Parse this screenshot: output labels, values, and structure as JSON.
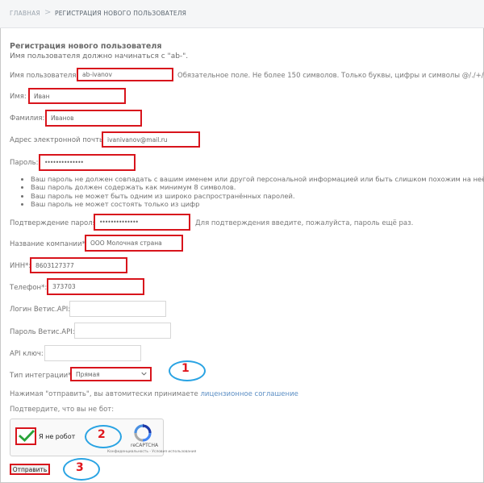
{
  "breadcrumb": {
    "home": "ГЛАВНАЯ",
    "separator": ">",
    "current": "РЕГИСТРАЦИЯ НОВОГО ПОЛЬЗОВАТЕЛЯ"
  },
  "form": {
    "title": "Регистрация нового пользователя",
    "subtitle": "Имя пользователя должно начинаться с \"ab-\".",
    "username": {
      "label": "Имя пользователя:",
      "value": "ab-ivanov",
      "hint": "Обязательное поле. Не более 150 символов. Только буквы, цифры и символы @/./+/-/_."
    },
    "first_name": {
      "label": "Имя:",
      "value": "Иван"
    },
    "last_name": {
      "label": "Фамилия:",
      "value": "Иванов"
    },
    "email": {
      "label": "Адрес электронной почты:",
      "value": "ivanivanov@mail.ru"
    },
    "password": {
      "label": "Пароль:",
      "value": "••••••••••••••",
      "rules": [
        "Ваш пароль не должен совпадать с вашим именем или другой персональной информацией или быть слишком похожим на неё.",
        "Ваш пароль должен содержать как минимум 8 символов.",
        "Ваш пароль не может быть одним из широко распространённых паролей.",
        "Ваш пароль не может состоять только из цифр"
      ]
    },
    "password_confirm": {
      "label": "Подтверждение пароля:",
      "value": "••••••••••••••",
      "hint": "Для подтверждения введите, пожалуйста, пароль ещё раз."
    },
    "company": {
      "label": "Название компании*:",
      "value": "ООО Молочная страна"
    },
    "inn": {
      "label": "ИНН*:",
      "value": "8603127377"
    },
    "phone": {
      "label": "Телефон*:",
      "value": "373703"
    },
    "vetis_login": {
      "label": "Логин Ветис.API:",
      "value": ""
    },
    "vetis_password": {
      "label": "Пароль Ветис.API:",
      "value": ""
    },
    "api_key": {
      "label": "API ключ:",
      "value": ""
    },
    "integration_type": {
      "label": "Тип интеграции*:",
      "value": "Прямая"
    },
    "agreement": {
      "text": "Нажимая \"отправить\", вы автомитески принимаете",
      "link": "лицензионное соглашение"
    },
    "confirm_text": "Подтвердите, что вы не бот:",
    "captcha": {
      "label": "Я не робот",
      "brand": "reCAPTCHA",
      "links": "Конфиденциальность - Условия использования"
    },
    "submit_label": "Отправить"
  },
  "annotations": {
    "c1": "1",
    "c2": "2",
    "c3": "3"
  },
  "colors": {
    "highlight": "#d8141c",
    "callout": "#29a3e3",
    "check": "#2aa33a",
    "link": "#5b8ec4"
  }
}
